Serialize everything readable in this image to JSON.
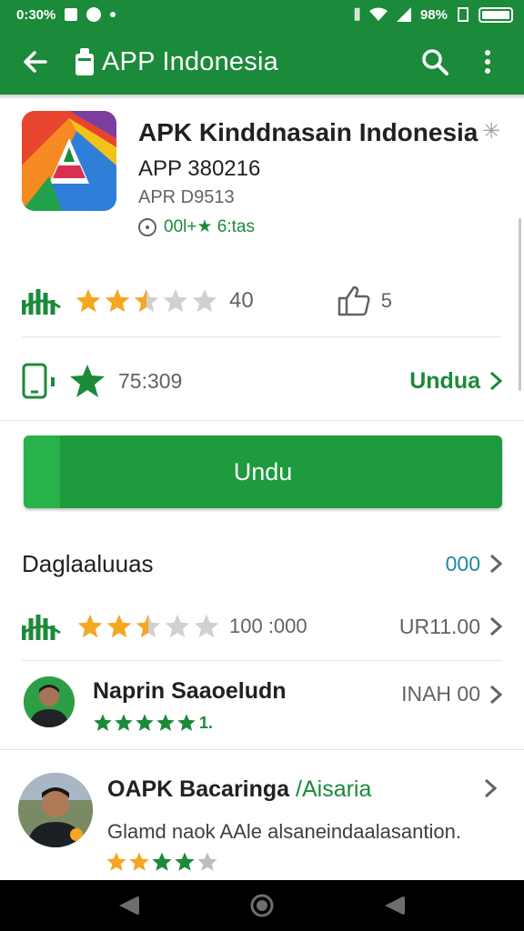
{
  "status_bar": {
    "time": "0:30%",
    "signal_text": "98%"
  },
  "app_bar": {
    "title": "APP Indonesia"
  },
  "app": {
    "name": "APK Kinddnasain Indonesia",
    "version": "APP 380216",
    "developer": "APR D9513",
    "meta": "00l+★ 6:tas"
  },
  "stats": {
    "rating_value": "40",
    "like_count": "5",
    "rating_stars": 2.5,
    "download_count": "75:309",
    "download_link": "Undua"
  },
  "install_button": {
    "label": "Undu"
  },
  "reviews_section": {
    "title": "Daglaaluuas",
    "more": "000",
    "summary_count": "100 :000",
    "summary_right": "UR11.00",
    "summary_stars": 2.5
  },
  "reviews": [
    {
      "name": "Naprin Saaoeludn",
      "right": "INAH 00",
      "stars": 5,
      "star_suffix": "1."
    },
    {
      "name": "OAPK Bacaringa",
      "tag": "/Aisaria",
      "text": "Glamd naok AAle alsaneindaalasantion.",
      "stars": 4
    }
  ],
  "colors": {
    "primary": "#1b8a3a",
    "button": "#1e9a3f",
    "link": "#1e8aa0",
    "star": "#f5a623"
  }
}
